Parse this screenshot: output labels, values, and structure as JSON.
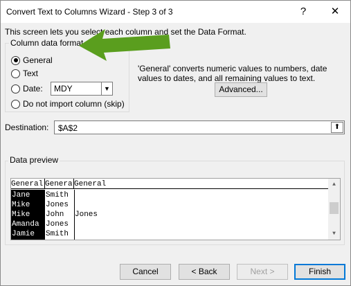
{
  "window": {
    "title": "Convert Text to Columns Wizard - Step 3 of 3",
    "help_glyph": "?",
    "close_glyph": "✕"
  },
  "intro_text": "This screen lets you select each column and set the Data Format.",
  "format_group": {
    "legend": "Column data format",
    "options": [
      {
        "label": "General",
        "checked": true
      },
      {
        "label": "Text",
        "checked": false
      },
      {
        "label": "Date:",
        "checked": false
      },
      {
        "label": "Do not import column (skip)",
        "checked": false
      }
    ],
    "date_value": "MDY"
  },
  "description": "'General' converts numeric values to numbers, date values to dates, and all remaining values to text.",
  "advanced_label": "Advanced...",
  "destination": {
    "label": "Destination:",
    "value": "$A$2"
  },
  "preview": {
    "legend": "Data preview",
    "headers": [
      "General",
      "General",
      "General"
    ],
    "rows": [
      [
        "Jane",
        "Smith",
        ""
      ],
      [
        "Mike",
        "Jones",
        ""
      ],
      [
        "Mike",
        "John",
        "Jones"
      ],
      [
        "Amanda",
        "Jones",
        ""
      ],
      [
        "Jamie",
        "Smith",
        ""
      ]
    ]
  },
  "footer": {
    "cancel": "Cancel",
    "back": "< Back",
    "next": "Next >",
    "finish": "Finish"
  },
  "colors": {
    "accent": "#0078d7",
    "annotation_arrow": "#5a9e1e"
  },
  "icons": [
    "help-icon",
    "close-icon",
    "chevron-down-icon",
    "collapse-dialog-icon",
    "scroll-up-icon",
    "scroll-down-icon",
    "annotation-arrow-icon"
  ]
}
